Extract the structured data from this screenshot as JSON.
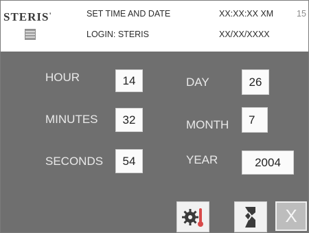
{
  "header": {
    "brand": "STERIS",
    "brand_mark": "'",
    "screen_title": "SET TIME AND DATE",
    "login": "LOGIN: STERIS",
    "time_placeholder": "XX:XX:XX XM",
    "date_placeholder": "XX/XX/XXXX",
    "corner_value": "15"
  },
  "fields": {
    "hour": {
      "label": "HOUR",
      "value": "14"
    },
    "minutes": {
      "label": "MINUTES",
      "value": "32"
    },
    "seconds": {
      "label": "SECONDS",
      "value": "54"
    },
    "day": {
      "label": "DAY",
      "value": "26"
    },
    "month": {
      "label": "MONTH",
      "value": "7"
    },
    "year": {
      "label": "YEAR",
      "value": "2004"
    }
  },
  "buttons": {
    "settings_icon": "gear-thermometer-icon",
    "document_icon": "document-scroll-icon",
    "close_label": "X"
  },
  "colors": {
    "panel": "#6f6f6f",
    "header": "#ffffff",
    "field": "#fbfbfb"
  }
}
